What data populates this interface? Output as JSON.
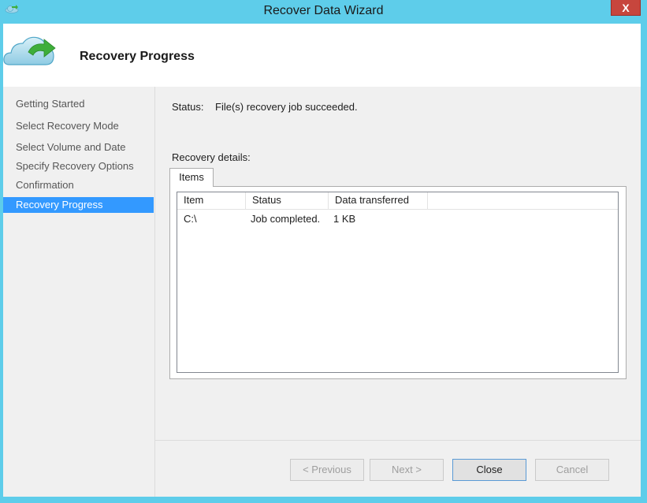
{
  "window": {
    "title": "Recover Data Wizard",
    "close_glyph": "X",
    "app_icon": "cloud-recovery-icon"
  },
  "header": {
    "icon": "cloud-refresh-icon",
    "title": "Recovery Progress"
  },
  "sidebar": {
    "steps": [
      {
        "label": "Getting Started",
        "active": false
      },
      {
        "label": "Select Recovery Mode",
        "active": false
      },
      {
        "label": "Select Volume and Date",
        "active": false
      },
      {
        "label": "Specify Recovery Options",
        "active": false
      },
      {
        "label": "Confirmation",
        "active": false
      },
      {
        "label": "Recovery Progress",
        "active": true
      }
    ]
  },
  "main": {
    "status_label": "Status:",
    "status_value": "File(s) recovery job succeeded.",
    "details_label": "Recovery details:",
    "tab_label": "Items",
    "table": {
      "columns": [
        "Item",
        "Status",
        "Data transferred"
      ],
      "rows": [
        [
          "C:\\",
          "Job completed.",
          "1 KB"
        ]
      ]
    }
  },
  "footer": {
    "previous_label": "< Previous",
    "next_label": "Next >",
    "close_label": "Close",
    "cancel_label": "Cancel"
  },
  "colors": {
    "frame": "#5ecdea",
    "selection": "#3399ff",
    "close_button": "#c7463d",
    "cloud_green": "#3eae3a"
  }
}
